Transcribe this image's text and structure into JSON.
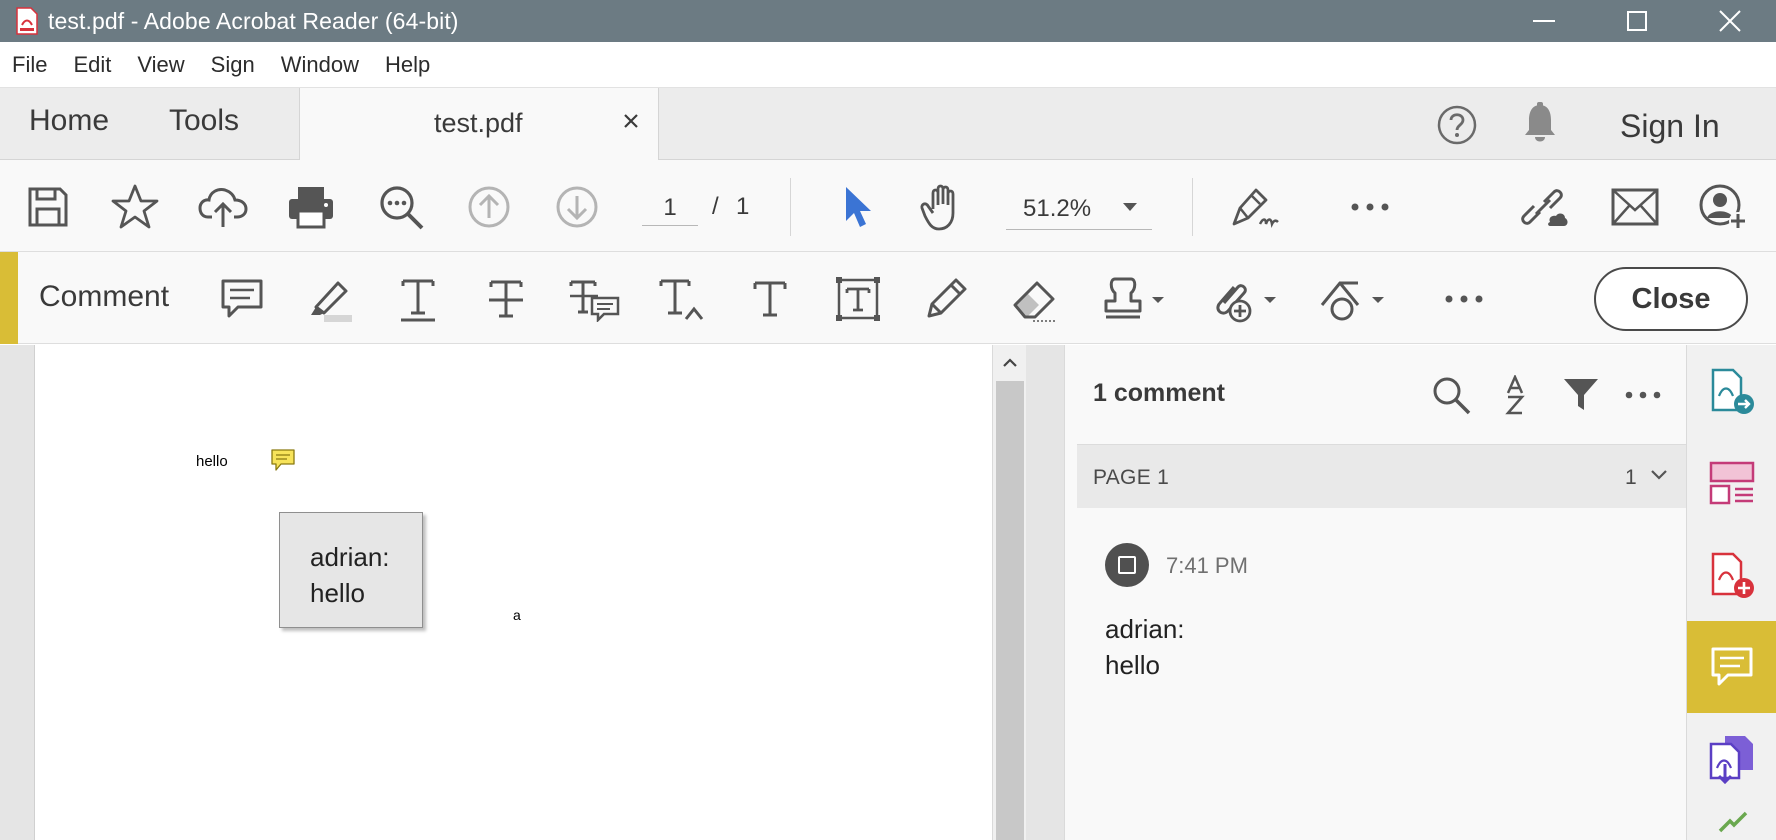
{
  "window": {
    "title": "test.pdf - Adobe Acrobat Reader (64-bit)"
  },
  "menu": [
    "File",
    "Edit",
    "View",
    "Sign",
    "Window",
    "Help"
  ],
  "tabs": {
    "home": "Home",
    "tools": "Tools",
    "document": "test.pdf",
    "sign_in": "Sign In"
  },
  "toolbar": {
    "current_page": "1",
    "page_separator": "/",
    "total_pages": "1",
    "zoom": "51.2%"
  },
  "comment_toolbar": {
    "label": "Comment",
    "close_label": "Close"
  },
  "document": {
    "text_hello": "hello",
    "popup_lines": [
      "adrian:",
      "hello"
    ],
    "text_a": "a"
  },
  "comments_pane": {
    "count_label": "1 comment",
    "page_label": "PAGE 1",
    "page_count": "1",
    "comment": {
      "time": "7:41 PM",
      "lines": [
        "adrian:",
        "hello"
      ]
    }
  },
  "colors": {
    "titlebar": "#6c7b83",
    "accent": "#d9bd36",
    "selection_blue": "#3b74d4",
    "pdf_red": "#d8323c"
  }
}
